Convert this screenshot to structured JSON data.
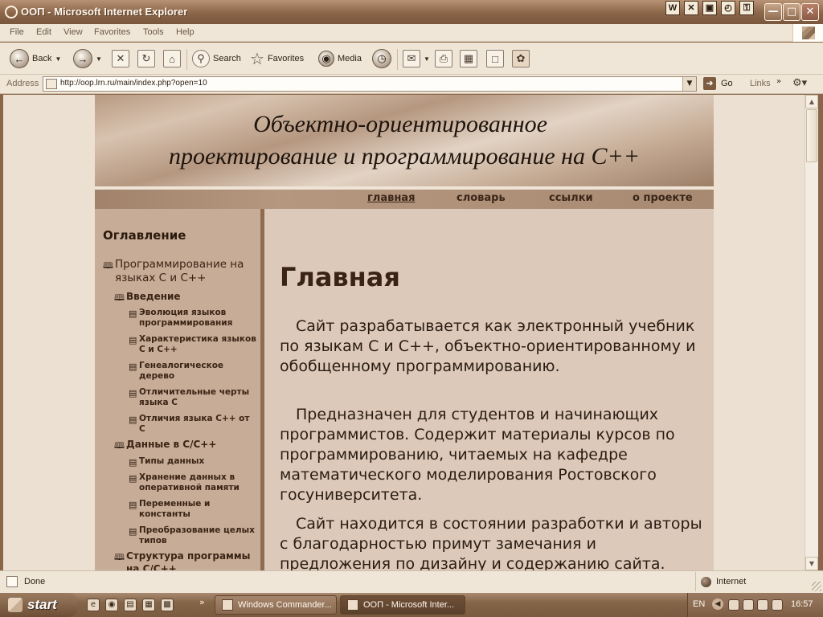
{
  "window": {
    "title": "ООП - Microsoft Internet Explorer",
    "tray_icons": [
      "W",
      "✕",
      "▣",
      "◴",
      "⚿"
    ]
  },
  "menu": [
    "File",
    "Edit",
    "View",
    "Favorites",
    "Tools",
    "Help"
  ],
  "toolbar": {
    "back_label": "Back",
    "search_label": "Search",
    "favorites_label": "Favorites",
    "media_label": "Media"
  },
  "address": {
    "label": "Address",
    "url": "http://oop.lrn.ru/main/index.php?open=10",
    "go_label": "Go",
    "links_label": "Links"
  },
  "site": {
    "banner_line1": "Объектно-ориентированное",
    "banner_line2": "проектирование и программирование на  С++",
    "nav": [
      "главная",
      "словарь",
      "ссылки",
      "о проекте"
    ]
  },
  "toc": {
    "title": "Оглавление",
    "items": [
      {
        "text": "Программирование на языках С и С++"
      },
      {
        "text": "Введение"
      },
      {
        "text": "Эволюция языков программирования"
      },
      {
        "text": "Характеристика языков С и С++"
      },
      {
        "text": "Генеалогическое дерево"
      },
      {
        "text": "Отличительные черты языка С"
      },
      {
        "text": "Отличия языка С++ от С"
      },
      {
        "text": "Данные в С/С++"
      },
      {
        "text": "Типы данных"
      },
      {
        "text": "Хранение данных в оперативной памяти"
      },
      {
        "text": "Переменные и константы"
      },
      {
        "text": "Преобразование целых типов"
      },
      {
        "text": "Структура программы на С/С++"
      }
    ]
  },
  "main": {
    "title": "Главная",
    "paragraphs": [
      "Сайт разрабатывается как электронный учебник по языкам С и С++, объектно-ориентированному и обобщенному программированию.",
      "Предназначен для студентов и начинающих программистов. Содержит материалы курсов по программированию, читаемых на кафедре математического моделирования Ростовского госуниверситета.",
      "Сайт находится в состоянии разработки и авторы с благодарностью примут замечания и предложения по дизайну и содержанию сайта."
    ]
  },
  "status": {
    "text": "Done",
    "zone": "Internet"
  },
  "taskbar": {
    "start_label": "start",
    "tasks": [
      "Windows Commander...",
      "ООП - Microsoft Inter..."
    ],
    "language": "EN",
    "clock": "16:57"
  }
}
